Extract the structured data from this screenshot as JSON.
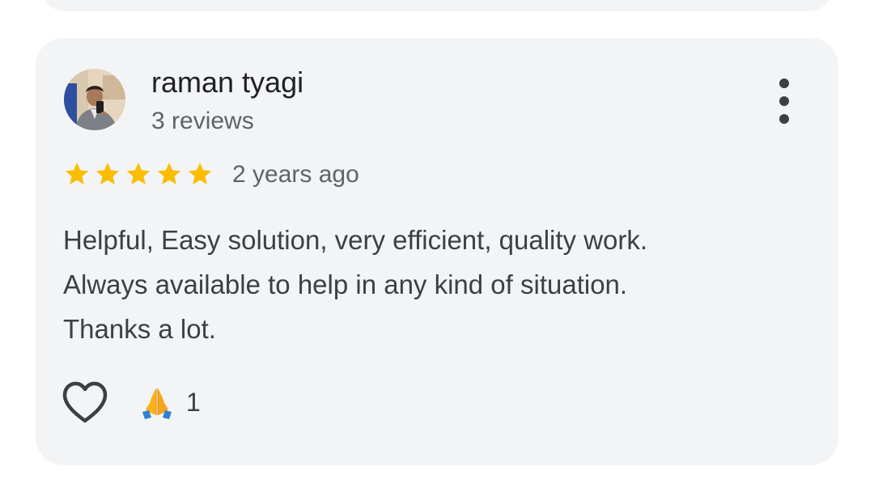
{
  "review": {
    "author": "raman tyagi",
    "author_meta": "3 reviews",
    "rating": 5,
    "max_rating": 5,
    "time": "2 years ago",
    "text": "Helpful, Easy solution, very efficient, quality work.\nAlways available to help in any kind of situation.\nThanks a lot.",
    "reaction_count": "1"
  },
  "icons": {
    "menu": "more-vert-icon",
    "like": "heart-outline-icon",
    "reaction": "folded-hands-emoji",
    "star": "star-filled-icon"
  },
  "colors": {
    "card_bg": "#f3f4f6",
    "star": "#fbbc04",
    "text_primary": "#202124",
    "text_secondary": "#5f6368"
  }
}
